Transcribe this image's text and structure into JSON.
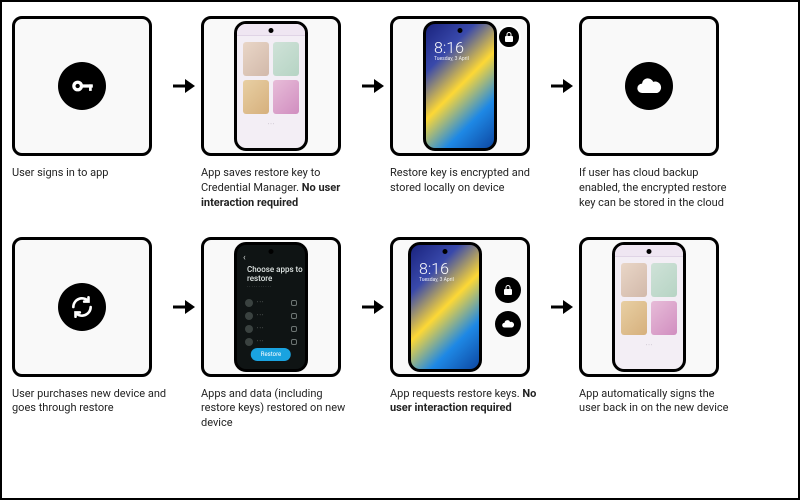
{
  "flow": {
    "lock_time": "8:16",
    "lock_date": "Tuesday, 3 April",
    "restore_screen": {
      "title": "Choose apps to restore",
      "button": "Restore"
    }
  },
  "row1": [
    {
      "caption": "User signs in to app",
      "bold": ""
    },
    {
      "caption": "App saves restore key to Credential Manager. ",
      "bold": "No user interaction required"
    },
    {
      "caption": "Restore key is encrypted and stored locally on device",
      "bold": ""
    },
    {
      "caption": "If user has cloud backup enabled, the encrypted restore key can be stored in the cloud",
      "bold": ""
    }
  ],
  "row2": [
    {
      "caption": "User purchases new device and goes through restore",
      "bold": ""
    },
    {
      "caption": "Apps and data (including restore keys) restored on new device",
      "bold": ""
    },
    {
      "caption": "App requests restore keys. ",
      "bold": "No user interaction required"
    },
    {
      "caption": "App automatically signs the user back in on the new device",
      "bold": ""
    }
  ]
}
